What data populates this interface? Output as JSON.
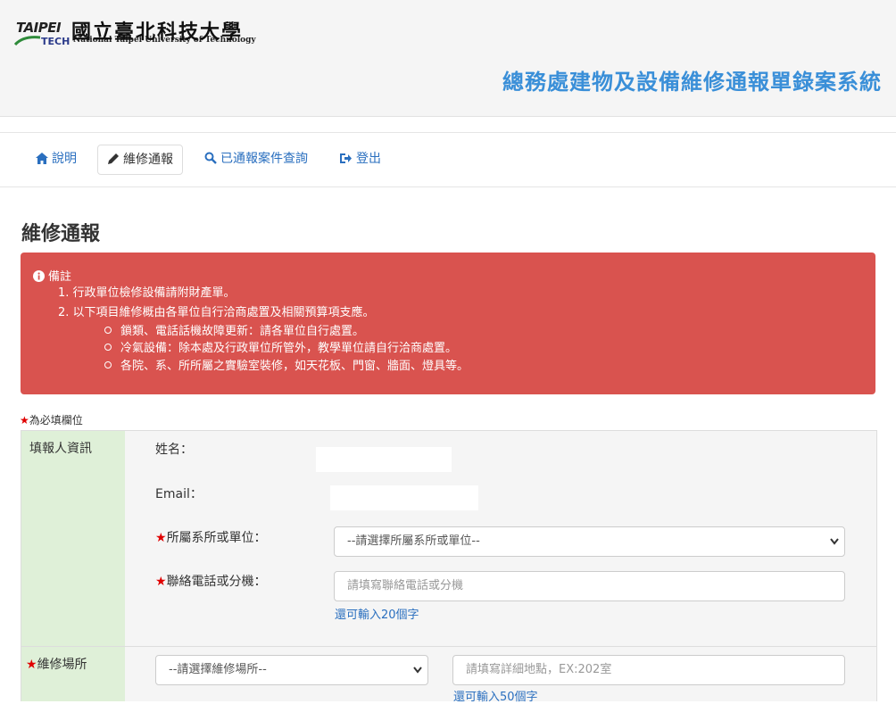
{
  "header": {
    "logo_word": "TAIPEI",
    "logo_word2": "TECH",
    "logo_university_en": "National Taipei University of Technology",
    "logo_university_cn": "國立臺北科技大學",
    "system_title": "總務處建物及設備維修通報單錄案系統"
  },
  "nav": {
    "items": [
      {
        "label": "說明",
        "icon": "home-icon"
      },
      {
        "label": "維修通報",
        "icon": "pencil-icon"
      },
      {
        "label": "已通報案件查詢",
        "icon": "search-icon"
      },
      {
        "label": "登出",
        "icon": "logout-icon"
      }
    ]
  },
  "page": {
    "title": "維修通報"
  },
  "alert": {
    "heading": "備註",
    "line1": "1. 行政單位檢修設備請附財產單。",
    "line2": "2. 以下項目維修概由各單位自行洽商處置及相關預算項支應。",
    "sub1": "鎖類、電話話機故障更新：請各單位自行處置。",
    "sub2": "冷氣設備：除本處及行政單位所管外，教學單位請自行洽商處置。",
    "sub3": "各院、系、所所屬之實驗室裝修，如天花板、門窗、牆面、燈具等。",
    "color": "#d9534f"
  },
  "form": {
    "required_star": "★",
    "required_note": "為必填欄位",
    "reporter_section": "填報人資訊",
    "name_label": "姓名：",
    "email_label": "Email：",
    "dept_label": "所屬系所或單位：",
    "dept_select_value": "--請選擇所屬系所或單位--",
    "phone_label": "聯絡電話或分機：",
    "phone_placeholder": "請填寫聯絡電話或分機",
    "phone_hint": "還可輸入20個字",
    "location_section": "維修場所",
    "location_select_value": "--請選擇維修場所--",
    "location_placeholder": "請填寫詳細地點，EX:202室",
    "location_hint": "還可輸入50個字"
  },
  "colors": {
    "title_blue": "#3a8fd8",
    "link_blue": "#2a6fbf",
    "section_green": "#dff0d8",
    "star_red": "#e00000"
  }
}
